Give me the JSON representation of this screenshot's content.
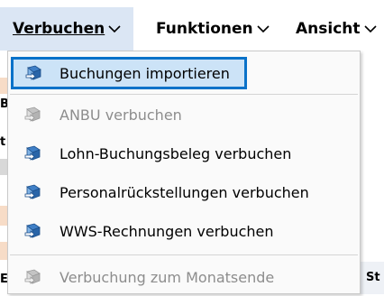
{
  "menubar": {
    "items": [
      {
        "label": "Verbuchen",
        "chevron": "chevron-down-icon"
      },
      {
        "label": "Funktionen",
        "chevron": "chevron-down-icon"
      },
      {
        "label": "Ansicht",
        "chevron": "chevron-down-icon"
      }
    ]
  },
  "dropdown": {
    "items": [
      {
        "label": "Buchungen importieren",
        "icon": "book-arrow-icon",
        "state": "hovered"
      },
      {
        "label": "ANBU verbuchen",
        "icon": "book-arrow-icon",
        "state": "disabled"
      },
      {
        "label": "Lohn-Buchungsbeleg verbuchen",
        "icon": "book-arrow-icon",
        "state": "enabled"
      },
      {
        "label": "Personalrückstellungen verbuchen",
        "icon": "book-arrow-icon",
        "state": "enabled"
      },
      {
        "label": "WWS-Rechnungen verbuchen",
        "icon": "book-arrow-icon",
        "state": "enabled"
      },
      {
        "label": "Verbuchung zum Monatsende",
        "icon": "book-arrow-icon",
        "state": "disabled"
      }
    ]
  },
  "background": {
    "fragment_1": "Bu",
    "fragment_2": "t",
    "fragment_3": "E",
    "fragment_4": "St"
  },
  "colors": {
    "highlight_border": "#0a72c9",
    "highlight_fill": "#cce3f7",
    "active_menu": "#dbe6f4",
    "disabled_text": "#8d8d8d"
  }
}
